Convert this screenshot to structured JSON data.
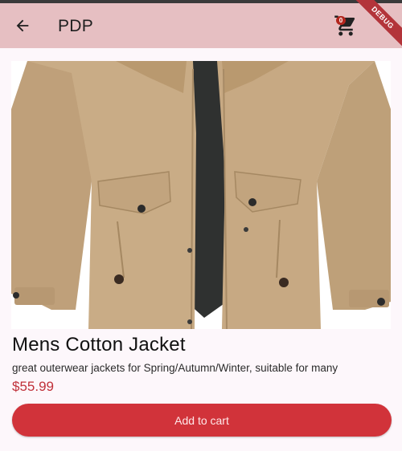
{
  "appbar": {
    "title": "PDP",
    "back_icon": "arrow-left-icon",
    "cart_icon": "shopping-cart-icon",
    "cart_count": "0",
    "debug_label": "DEBUG",
    "background": "#e6bfc2"
  },
  "product": {
    "name": "Mens Cotton Jacket",
    "description": "great outerwear jackets for Spring/Autumn/Winter, suitable for many",
    "price": "$55.99",
    "image_subject": "khaki-cotton-jacket"
  },
  "actions": {
    "add_to_cart_label": "Add to cart",
    "accent": "#d1333a"
  }
}
